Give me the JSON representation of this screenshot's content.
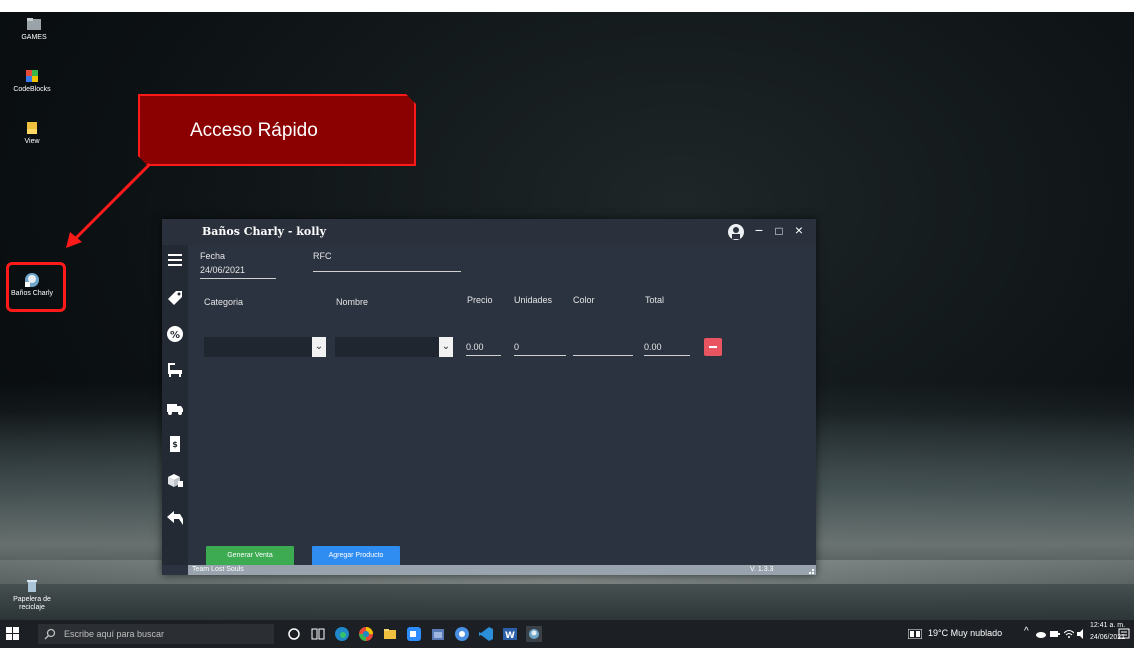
{
  "desktop": {
    "icons": [
      {
        "label": "GAMES"
      },
      {
        "label": "CodeBlocks"
      },
      {
        "label": "View"
      },
      {
        "label": "Baños Charly"
      },
      {
        "label": "Papelera de reciclaje"
      }
    ]
  },
  "callout": {
    "text": "Acceso Rápido"
  },
  "app": {
    "title": "Baños Charly - kolly",
    "controls": {
      "minimize": "−",
      "maximize": "□",
      "close": "×"
    },
    "fields": {
      "fecha_label": "Fecha",
      "fecha_value": "24/06/2021",
      "rfc_label": "RFC",
      "rfc_value": ""
    },
    "columns": {
      "categoria": "Categoria",
      "nombre": "Nombre",
      "precio": "Precio",
      "unidades": "Unidades",
      "color": "Color",
      "total": "Total"
    },
    "row": {
      "precio": "0.00",
      "unidades": "0",
      "color": "",
      "total": "0.00"
    },
    "buttons": {
      "generar": "Generar Venta",
      "agregar": "Agregar Producto"
    },
    "status": {
      "team": "Team Lost Souls",
      "version": "V. 1.3.3"
    }
  },
  "taskbar": {
    "search_placeholder": "Escribe aquí para buscar",
    "weather": "19°C Muy nublado",
    "time": "12:41 a. m.",
    "date": "24/06/2021"
  },
  "colors": {
    "callout_bg": "#8b0000",
    "callout_border": "#ff1a1a",
    "app_bg": "#2b3340",
    "btn_generar": "#3dab52",
    "btn_agregar": "#2f8cf0",
    "btn_delete": "#e8545f"
  }
}
